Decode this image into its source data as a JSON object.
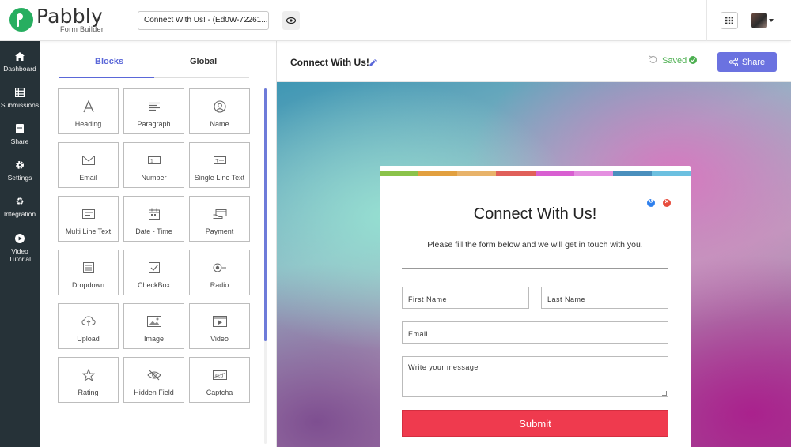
{
  "app": {
    "logo_word": "Pabbly",
    "logo_sub": "Form Builder",
    "form_title_input": "Connect With Us! - (Ed0W-72261..."
  },
  "colors": {
    "nav_bg": "#263238",
    "accent": "#5a67d8",
    "share_button": "#6b72e0",
    "saved_green": "#4caf50",
    "submit_red": "#ef3a4e",
    "logo_green": "#27ae60"
  },
  "topbar": {
    "icons": [
      "eye-icon",
      "apps-grid-icon",
      "avatar",
      "caret-down-icon"
    ]
  },
  "nav": {
    "items": [
      {
        "label": "Dashboard",
        "icon": "home-icon"
      },
      {
        "label": "Submissions",
        "icon": "table-icon"
      },
      {
        "label": "Share",
        "icon": "share-doc-icon"
      },
      {
        "label": "Settings",
        "icon": "gear-icon"
      },
      {
        "label": "Integration",
        "icon": "recycle-icon"
      },
      {
        "label": "Video Tutorial",
        "label_line1": "Video",
        "label_line2": "Tutorial",
        "icon": "play-icon"
      }
    ]
  },
  "panel": {
    "tabs": [
      {
        "label": "Blocks",
        "active": true
      },
      {
        "label": "Global",
        "active": false
      }
    ],
    "blocks": [
      {
        "label": "Heading",
        "icon": "heading-icon"
      },
      {
        "label": "Paragraph",
        "icon": "paragraph-icon"
      },
      {
        "label": "Name",
        "icon": "user-circle-icon"
      },
      {
        "label": "Email",
        "icon": "envelope-icon"
      },
      {
        "label": "Number",
        "icon": "number-icon"
      },
      {
        "label": "Single Line Text",
        "icon": "single-line-icon"
      },
      {
        "label": "Multi Line Text",
        "icon": "multi-line-icon"
      },
      {
        "label": "Date - Time",
        "icon": "calendar-icon"
      },
      {
        "label": "Payment",
        "icon": "payment-icon"
      },
      {
        "label": "Dropdown",
        "icon": "dropdown-icon"
      },
      {
        "label": "CheckBox",
        "icon": "checkbox-icon"
      },
      {
        "label": "Radio",
        "icon": "radio-icon"
      },
      {
        "label": "Upload",
        "icon": "cloud-upload-icon"
      },
      {
        "label": "Image",
        "icon": "image-icon"
      },
      {
        "label": "Video",
        "icon": "video-icon"
      },
      {
        "label": "Rating",
        "icon": "star-icon"
      },
      {
        "label": "Hidden Field",
        "icon": "eye-slash-icon"
      },
      {
        "label": "Captcha",
        "icon": "captcha-icon"
      }
    ]
  },
  "header": {
    "title": "Connect With Us!",
    "saved": "Saved",
    "share": "Share"
  },
  "form": {
    "title": "Connect With Us!",
    "subtitle": "Please fill the form below and we will get in touch with you.",
    "fields": {
      "first_name": "First Name",
      "last_name": "Last Name",
      "email": "Email",
      "message": "Write your message"
    },
    "submit": "Submit",
    "color_bar": [
      "#8bc34a",
      "#e2a03f",
      "#e8b36a",
      "#e0605a",
      "#d85fd1",
      "#e48fe0",
      "#4a8fbd",
      "#6cc0e0"
    ]
  }
}
